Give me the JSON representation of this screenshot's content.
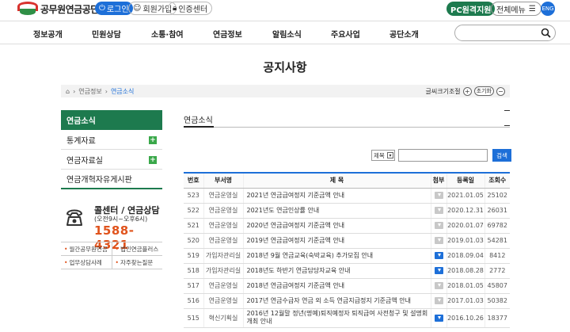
{
  "header": {
    "logo_text": "공무원연금공단",
    "login": "로그인",
    "join": "회원가입",
    "cert": "인증센터",
    "pc_remote": "PC원격지원",
    "all_menu": "전체메뉴",
    "eng": "ENG"
  },
  "nav": {
    "items": [
      "정보공개",
      "민원상담",
      "소통·참여",
      "연금정보",
      "알림소식",
      "주요사업",
      "공단소개"
    ],
    "search_placeholder": ""
  },
  "page_title": "공지사항",
  "breadcrumb": {
    "items": [
      "연금정보",
      "연금소식"
    ],
    "font_size_label": "글씨크기조절",
    "plus": "+",
    "reset": "초기화",
    "minus": "−"
  },
  "sidebar": {
    "items": [
      "연금소식",
      "통계자료",
      "연금자료실",
      "연금개혁자유게시판"
    ],
    "plus": "+"
  },
  "callcenter": {
    "title": "콜센터 / 연금상담",
    "hours": "(오전9시~오후6시)",
    "number": "1588-4321"
  },
  "quicklinks": [
    "월간공무원연금",
    "법인연금플러스",
    "업무상담사례",
    "자주찾는질문"
  ],
  "content": {
    "tab_title": "연금소식",
    "filter_select": "제목",
    "search_button": "검색"
  },
  "table": {
    "headers": [
      "번호",
      "부서명",
      "제 목",
      "첨부",
      "등록일",
      "조회수"
    ],
    "rows": [
      {
        "no": "523",
        "dept": "연금운영실",
        "title": "2021년 연금급여정지 기준금액 안내",
        "att": "gray",
        "date": "2021.01.05",
        "views": "25102"
      },
      {
        "no": "522",
        "dept": "연금운영실",
        "title": "2021년도 연금인상률 안내",
        "att": "gray",
        "date": "2020.12.31",
        "views": "26031"
      },
      {
        "no": "521",
        "dept": "연금운영실",
        "title": "2020년 연금급여정지 기준금액 안내",
        "att": "gray",
        "date": "2020.01.07",
        "views": "69782"
      },
      {
        "no": "520",
        "dept": "연금운영실",
        "title": "2019년 연금급여정지 기준금액 안내",
        "att": "gray",
        "date": "2019.01.03",
        "views": "54281"
      },
      {
        "no": "519",
        "dept": "가입자관리실",
        "title": "2018년 9월 연금교육(숙박교육) 추가모집 안내",
        "att": "blue",
        "date": "2018.09.04",
        "views": "8412"
      },
      {
        "no": "518",
        "dept": "가입자관리실",
        "title": "2018년도 하반기 연금담당자교육 안내",
        "att": "blue",
        "date": "2018.08.28",
        "views": "2772"
      },
      {
        "no": "517",
        "dept": "연금운영실",
        "title": "2018년 연금급여정지 기준금액 안내",
        "att": "gray",
        "date": "2018.01.05",
        "views": "45807"
      },
      {
        "no": "516",
        "dept": "연금운영실",
        "title": "2017년 연금수급자 연금 외 소득 연금지급정지 기준금액 안내",
        "att": "gray",
        "date": "2017.01.03",
        "views": "50382"
      },
      {
        "no": "515",
        "dept": "혁신기획실",
        "title": "2016년 12월말 정년(명예)퇴직예정자 퇴직급여 사전청구 및 설명회 개최 안내",
        "att": "blue",
        "date": "2016.10.26",
        "views": "18377"
      }
    ]
  }
}
